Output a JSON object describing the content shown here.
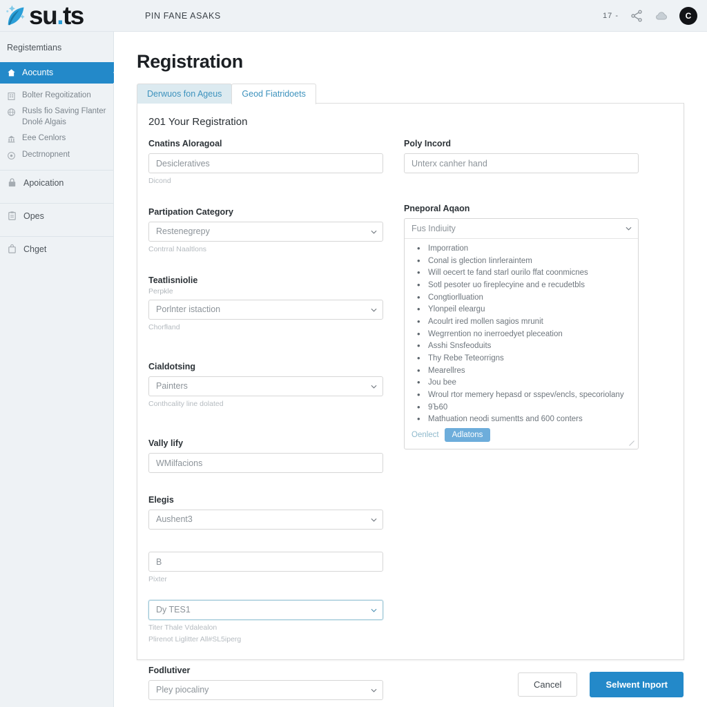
{
  "topbar": {
    "brand_text_prefix": "s",
    "brand_text_u": "u",
    "brand_text_dot": ".",
    "brand_text_suffix": "ts",
    "title": "PIN FANE ASAKS",
    "count": "17 -",
    "avatar_initial": "C",
    "icons": {
      "share": "share-icon",
      "cloud": "cloud-icon",
      "avatar": "avatar-icon"
    }
  },
  "sidebar": {
    "title": "Registemtians",
    "items": [
      {
        "label": "Aocunts",
        "icon": "home-icon",
        "active": true
      },
      {
        "label": "Bolter Regoitization",
        "icon": "building-icon",
        "active": false
      },
      {
        "label": "Rusls fio Saving Flanter Dnolé Algais",
        "icon": "globe-icon",
        "active": false
      },
      {
        "label": "Eee Cenlors",
        "icon": "bank-icon",
        "active": false
      },
      {
        "label": "Dectrnopnent",
        "icon": "target-icon",
        "active": false
      }
    ],
    "major_items": [
      {
        "label": "Apoication",
        "icon": "lock-icon"
      },
      {
        "label": "Opes",
        "icon": "clipboard-icon"
      },
      {
        "label": "Chget",
        "icon": "bag-icon"
      }
    ]
  },
  "main": {
    "page_title": "Registration",
    "tabs": [
      {
        "label": "Derwuos fon Ageus",
        "active": false
      },
      {
        "label": "Geod Fiatridoets",
        "active": true
      }
    ],
    "card_heading": "201 Your Registration",
    "left_fields": [
      {
        "label": "Cnatins Aloragoal",
        "type": "input",
        "value": "Desicleratives",
        "hint": "Dicond"
      },
      {
        "label": "Partipation Category",
        "type": "select",
        "value": "Resteneɡrepy",
        "hint": "Contrral Naaltlons"
      },
      {
        "label": "Teatlisniolie",
        "sublabel": "Perpkle",
        "type": "select",
        "value": "Porlnter istaction",
        "hint": "Chorfłand"
      },
      {
        "label": "Cialdotsing",
        "type": "select",
        "value": "Painters",
        "hint": "Conthcality line dolated"
      },
      {
        "label": "Vally lify",
        "type": "input",
        "value": "WMilfacions",
        "hint": ""
      },
      {
        "label": "Elegis",
        "type": "select",
        "value": "Aushent3",
        "hint": ""
      },
      {
        "label": "",
        "type": "input",
        "value": "B",
        "hint": "Pixter"
      },
      {
        "label": "",
        "type": "select",
        "value": "Dy TES1",
        "focused": true,
        "hint": "Titer Thale Vdalealon",
        "hint2": "Plirenot Liglitter All#SL5iperg"
      },
      {
        "label": "Fodlutiver",
        "type": "select",
        "value": "Pley piocaliny",
        "hint": ""
      }
    ],
    "right_fields": [
      {
        "label": "Poly Incord",
        "type": "input",
        "value": "Unterx canher hand"
      },
      {
        "label": "Pneporal Aqaon",
        "type": "listbox",
        "value": "Fus Indiuity",
        "items": [
          "Imporration",
          "Conal is glection Iinrleraintem",
          "Will oecert te fand starl ourilo ffat coonmicnes",
          "Sotl pesoter uo fireplecyine and e recudetbls",
          "Congtiorlluation",
          "Ylonpeil eleargu",
          "Acoulrt ired mollen sagios mrunit",
          "Wegrrention no inerroedyet pleceation",
          "Asshi Snsfeoduits",
          "Thy Rebe Teteorrigns",
          "Mearellres",
          "Jou bee",
          "Wroul rtor memery hepasd or sspev/encls, specoriolany",
          "9Ъ60",
          "Mathuation neodi sumentts and 600 conters"
        ],
        "link_label": "Oenlect",
        "pill_label": "Adlatons"
      }
    ],
    "footer": {
      "cancel_label": "Cancel",
      "submit_label": "Selwent Inport"
    }
  },
  "colors": {
    "accent": "#2389c9",
    "tab_text": "#3d92bd",
    "tab_inactive_bg": "#dceaf0",
    "sidebar_bg": "#eef2f5",
    "pill": "#6daddb"
  }
}
